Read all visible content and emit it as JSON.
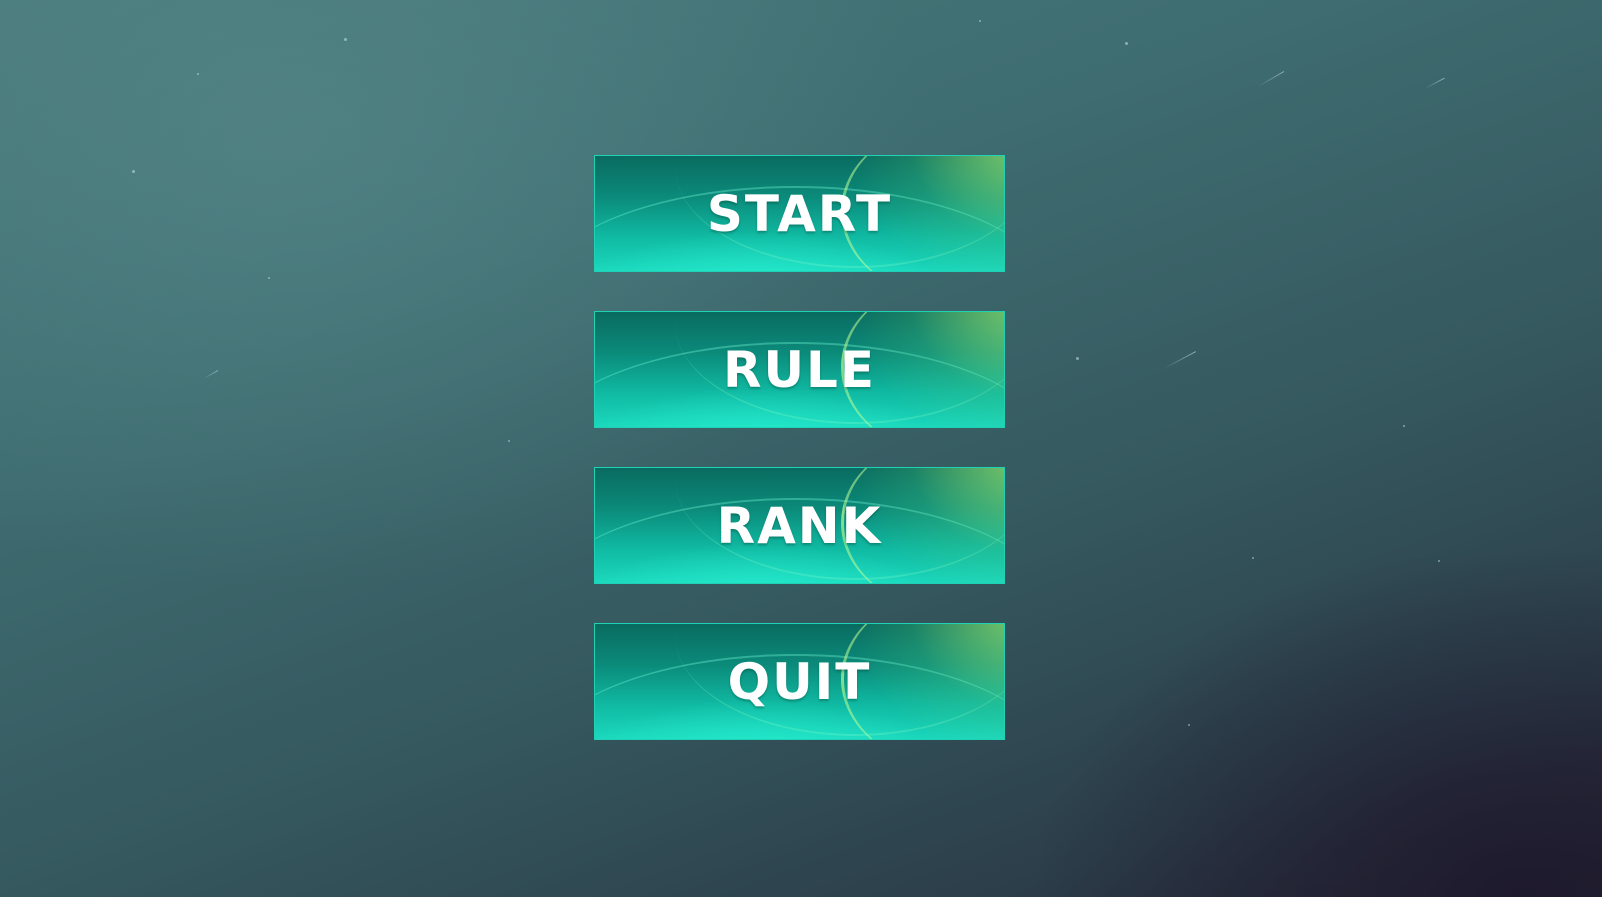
{
  "menu": {
    "buttons": [
      {
        "label": "START"
      },
      {
        "label": "RULE"
      },
      {
        "label": "RANK"
      },
      {
        "label": "QUIT"
      }
    ]
  },
  "colors": {
    "background_top": "#4a7a7c",
    "background_bottom": "#252433",
    "button_top": "#0a6b60",
    "button_bottom": "#1bd8bd",
    "button_border": "#1fd1b5",
    "label": "#ffffff"
  }
}
